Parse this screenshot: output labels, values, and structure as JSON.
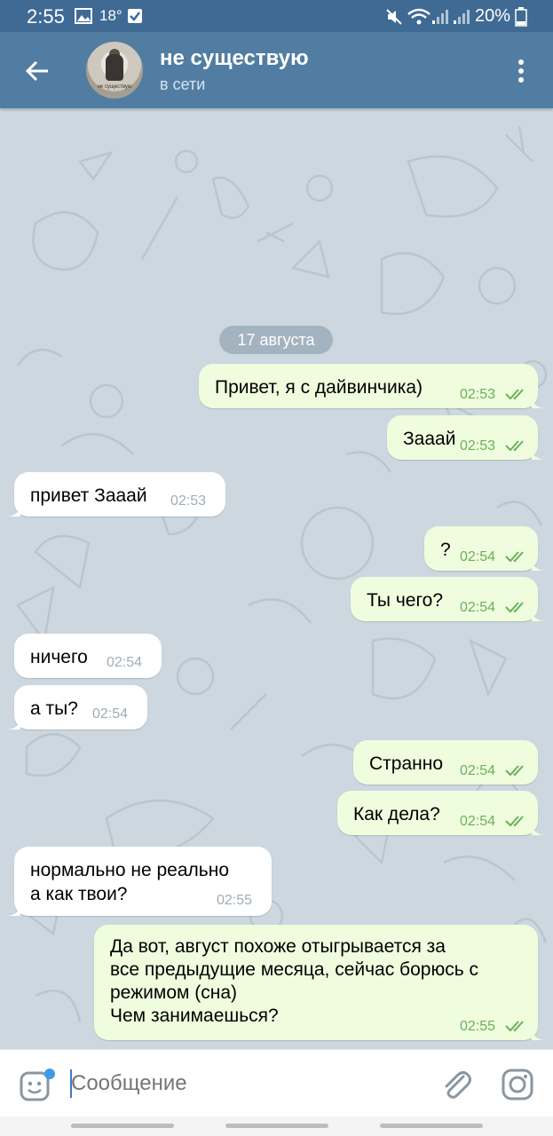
{
  "status_bar": {
    "time": "2:55",
    "temperature": "18°",
    "battery": "20%"
  },
  "header": {
    "title": "не существую",
    "subtitle": "в сети",
    "avatar_caption": "не существую"
  },
  "chat": {
    "date_label": "17 августа",
    "messages": [
      {
        "direction": "out",
        "text": "Привет, я с дайвинчика)",
        "time": "02:53",
        "read": true
      },
      {
        "direction": "out",
        "text": "Зааай",
        "time": "02:53",
        "read": true
      },
      {
        "direction": "in",
        "text": "привет Зааай",
        "time": "02:53"
      },
      {
        "direction": "out",
        "text": "?",
        "time": "02:54",
        "read": true
      },
      {
        "direction": "out",
        "text": "Ты чего?",
        "time": "02:54",
        "read": true
      },
      {
        "direction": "in",
        "text": "ничего",
        "time": "02:54"
      },
      {
        "direction": "in",
        "text": "а ты?",
        "time": "02:54"
      },
      {
        "direction": "out",
        "text": "Странно",
        "time": "02:54",
        "read": true
      },
      {
        "direction": "out",
        "text": "Как дела?",
        "time": "02:54",
        "read": true
      },
      {
        "direction": "in",
        "text": "нормально не реально\nа как твои?",
        "time": "02:55"
      },
      {
        "direction": "out",
        "text": "Да вот, август похоже отыгрывается за\nвсе предыдущие месяца, сейчас борюсь с\nрежимом (сна)\nЧем занимаешься?",
        "time": "02:55",
        "read": true
      }
    ]
  },
  "composer": {
    "placeholder": "Сообщение",
    "value": ""
  },
  "icons": {
    "back": "arrow-left-icon",
    "menu": "more-vertical-icon",
    "sticker": "sticker-icon",
    "attach": "paperclip-icon",
    "camera": "instagram-camera-icon"
  },
  "colors": {
    "header": "#517da2",
    "statusbar": "#3f6a94",
    "outgoing_bubble": "#effdde",
    "incoming_bubble": "#ffffff",
    "chat_bg": "#cdd7df",
    "accent": "#3d7ac1"
  }
}
